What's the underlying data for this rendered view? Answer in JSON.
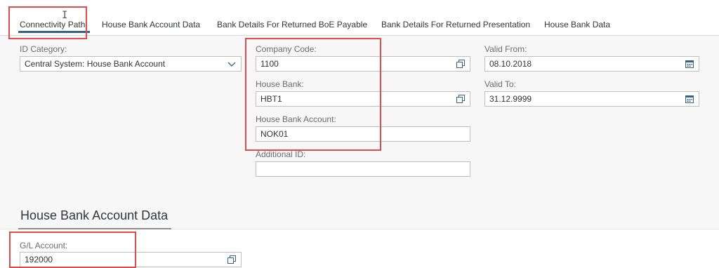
{
  "tabs": [
    {
      "label": "Connectivity Path",
      "active": true
    },
    {
      "label": "House Bank Account Data"
    },
    {
      "label": "Bank Details For Returned BoE Payable"
    },
    {
      "label": "Bank Details For Returned Presentation"
    },
    {
      "label": "House Bank Data"
    }
  ],
  "connectivity": {
    "id_category": {
      "label": "ID Category:",
      "value": "Central System: House Bank Account"
    },
    "company_code": {
      "label": "Company Code:",
      "value": "1100"
    },
    "house_bank": {
      "label": "House Bank:",
      "value": "HBT1"
    },
    "house_bank_account": {
      "label": "House Bank Account:",
      "value": "NOK01"
    },
    "additional_id": {
      "label": "Additional ID:",
      "value": ""
    },
    "valid_from": {
      "label": "Valid From:",
      "value": "08.10.2018"
    },
    "valid_to": {
      "label": "Valid To:",
      "value": "31.12.9999"
    }
  },
  "account_section": {
    "title": "House Bank Account Data",
    "gl_account": {
      "label": "G/L Account:",
      "value": "192000"
    }
  },
  "icons": {
    "value_help": "value-help-icon",
    "calendar": "calendar-icon",
    "dropdown": "chevron-down-icon"
  },
  "colors": {
    "highlight": "#e24b4b",
    "tab_active": "#346187",
    "section_bg": "#f7f7f7"
  }
}
